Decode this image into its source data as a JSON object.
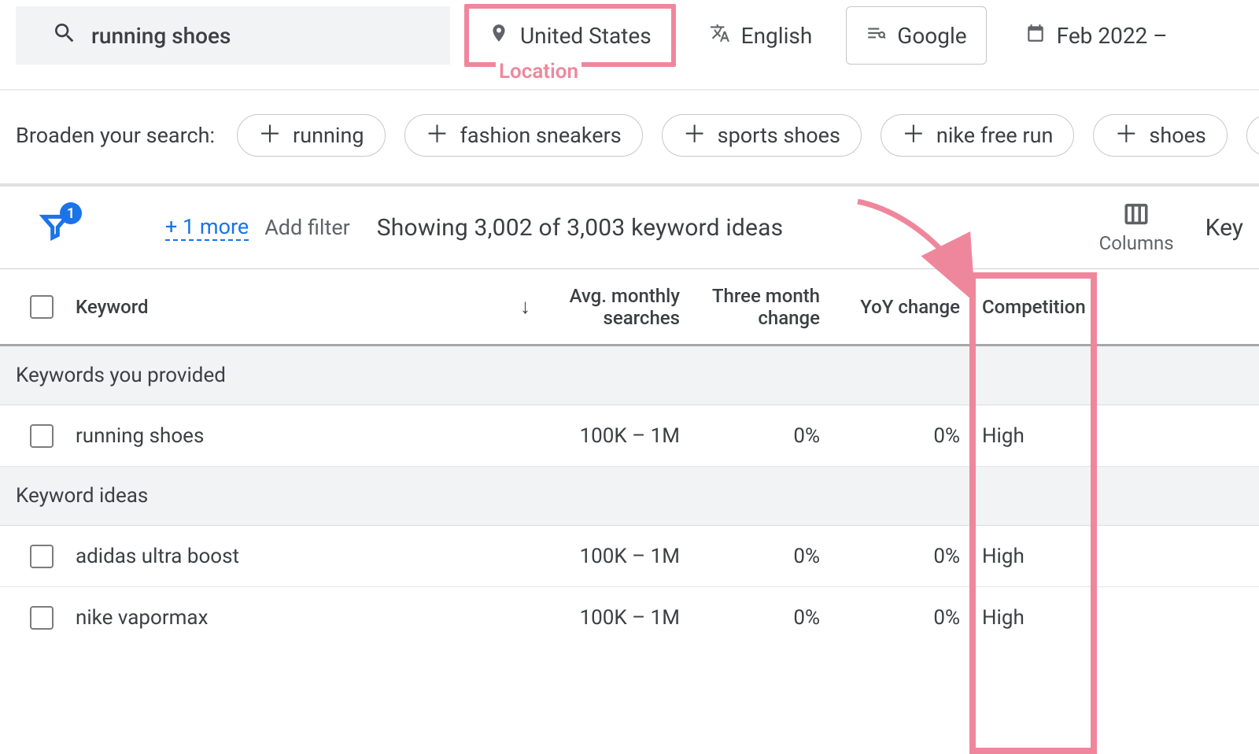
{
  "topbar": {
    "search_value": "running shoes",
    "location": "United States",
    "language": "English",
    "network": "Google",
    "date_range": "Feb 2022 –"
  },
  "annotation": {
    "location_label": "Location"
  },
  "broaden": {
    "label": "Broaden your search:",
    "chips": [
      "running",
      "fashion sneakers",
      "sports shoes",
      "nike free run",
      "shoes"
    ]
  },
  "toolbar": {
    "filter_count": "1",
    "more_link": "+ 1 more",
    "add_filter": "Add filter",
    "showing": "Showing 3,002 of 3,003 keyword ideas",
    "columns_label": "Columns",
    "right_cutoff": "Key"
  },
  "headers": {
    "keyword": "Keyword",
    "avg": "Avg. monthly searches",
    "three_month": "Three month change",
    "yoy": "YoY change",
    "competition": "Competition"
  },
  "sections": {
    "provided": "Keywords you provided",
    "ideas": "Keyword ideas"
  },
  "rows_provided": [
    {
      "keyword": "running shoes",
      "avg": "100K – 1M",
      "three_month": "0%",
      "yoy": "0%",
      "competition": "High"
    }
  ],
  "rows_ideas": [
    {
      "keyword": "adidas ultra boost",
      "avg": "100K – 1M",
      "three_month": "0%",
      "yoy": "0%",
      "competition": "High"
    },
    {
      "keyword": "nike vapormax",
      "avg": "100K – 1M",
      "three_month": "0%",
      "yoy": "0%",
      "competition": "High"
    }
  ]
}
